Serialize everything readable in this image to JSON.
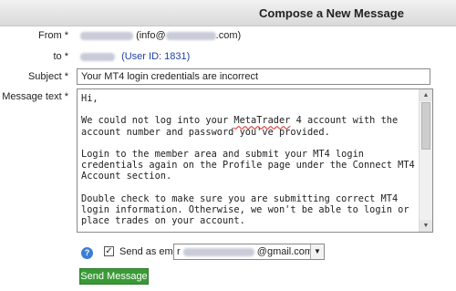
{
  "header": {
    "title": "Compose a New Message"
  },
  "labels": {
    "from": "From *",
    "to": "to *",
    "subject": "Subject *",
    "message": "Message text *"
  },
  "from": {
    "email_prefix": "(info@",
    "email_suffix": ".com)"
  },
  "to": {
    "user_id": "(User ID: 1831)"
  },
  "subject": {
    "value": "Your MT4 login credentials are incorrect"
  },
  "message": {
    "line1": "Hi,",
    "para1_a": "We could not log into your ",
    "para1_word": "MetaTrader",
    "para1_b": " 4 account with the\naccount number and password you've provided.",
    "para2": "Login to the member area and submit your MT4 login\ncredentials again on the Profile page under the Connect MT4\nAccount section.",
    "para3": "Double check to make sure you are submitting correct MT4\nlogin information. Otherwise, we won't be able to login or\nplace trades on your account."
  },
  "send_as_email": {
    "label": "Send as email",
    "checked": true,
    "email_prefix": "r",
    "email_suffix": "@gmail.com"
  },
  "send_button": {
    "label": "Send Message"
  },
  "icons": {
    "help": "help-icon",
    "checkbox": "checkbox",
    "dropdown": "chevron-down-icon"
  },
  "colors": {
    "button": "#3a9a36",
    "link": "#1f3ea8"
  }
}
